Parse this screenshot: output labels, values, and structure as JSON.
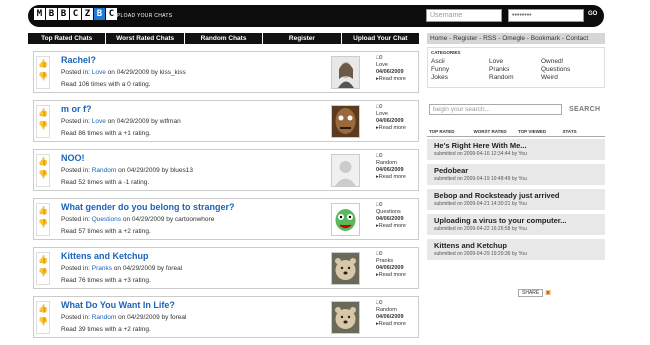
{
  "header": {
    "logo_letters": [
      "M",
      "B",
      "B",
      "C",
      "Z",
      "B",
      "C"
    ],
    "tagline": "UPLOAD YOUR CHATS",
    "username_placeholder": "Username",
    "password_value": "••••••••",
    "go_label": "GO"
  },
  "nav": [
    "Top Rated Chats",
    "Worst Rated Chats",
    "Random Chats",
    "Register",
    "Upload Your Chat"
  ],
  "posts": [
    {
      "title": "Rachel?",
      "category": "Love",
      "date": "04/29/2009",
      "author": "kiss_kiss",
      "read": "Read 106 times with a 0 rating.",
      "comments": "0",
      "info_cat": "Love",
      "info_date": "04/06/2009",
      "more": "Read more",
      "thumb": "girl-photo"
    },
    {
      "title": "m or f?",
      "category": "Love",
      "date": "04/29/2009",
      "author": "wtfman",
      "read": "Read 86 times with a +1 rating.",
      "comments": "0",
      "info_cat": "Love",
      "info_date": "04/06/2009",
      "more": "Read more",
      "thumb": "monster-mask"
    },
    {
      "title": "NOO!",
      "category": "Random",
      "date": "04/29/2009",
      "author": "blues13",
      "read": "Read 52 times with a -1 rating.",
      "comments": "0",
      "info_cat": "Random",
      "info_date": "04/06/2009",
      "more": "Read more",
      "thumb": "blank-avatar"
    },
    {
      "title": "What gender do you belong to stranger?",
      "category": "Questions",
      "date": "04/29/2009",
      "author": "cartoonwhore",
      "read": "Read 57 times with a +2 rating.",
      "comments": "0",
      "info_cat": "Questions",
      "info_date": "04/06/2009",
      "more": "Read more",
      "thumb": "cartoon-face"
    },
    {
      "title": "Kittens and Ketchup",
      "category": "Pranks",
      "date": "04/29/2009",
      "author": "foreal",
      "read": "Read 76 times with a +3 rating.",
      "comments": "0",
      "info_cat": "Pranks",
      "info_date": "04/06/2009",
      "more": "Read more",
      "thumb": "bear-photo"
    },
    {
      "title": "What Do You Want In Life?",
      "category": "Random",
      "date": "04/29/2009",
      "author": "foreal",
      "read": "Read 39 times with a +2 rating.",
      "comments": "0",
      "info_cat": "Random",
      "info_date": "04/06/2009",
      "more": "Read more",
      "thumb": "bear-photo"
    }
  ],
  "post_labels": {
    "posted_in": "Posted in:",
    "on": "on",
    "by": "by"
  },
  "sidebar": {
    "links": "Home - Register - RSS - Omegle - Bookmark - Contact",
    "categories_heading": "CATEGORIES",
    "categories": [
      "Ascii",
      "Love",
      "Owned!",
      "Funny",
      "Pranks",
      "Questions",
      "Jokes",
      "Random",
      "Weird"
    ],
    "search_placeholder": "begin your search...",
    "search_button": "SEARCH",
    "tabs": [
      "TOP RATED",
      "WORST RATED",
      "TOP VIEWED",
      "STATS"
    ],
    "top": [
      {
        "title": "He's Right Here With Me...",
        "sub": "submitted on 2009-04-16 12:34:44 by You"
      },
      {
        "title": "Pedobear",
        "sub": "submitted on 2009-04-19 19:48:49 by You"
      },
      {
        "title": "Bebop and Rocksteady just arrived",
        "sub": "submitted on 2009-04-21 14:30:21 by You"
      },
      {
        "title": "Uploading a virus to your computer...",
        "sub": "submitted on 2009-04-22 16:26:58 by You"
      },
      {
        "title": "Kittens and Ketchup",
        "sub": "submitted on 2009-04-29 19:29:36 by You"
      }
    ],
    "share_label": "SHARE"
  }
}
